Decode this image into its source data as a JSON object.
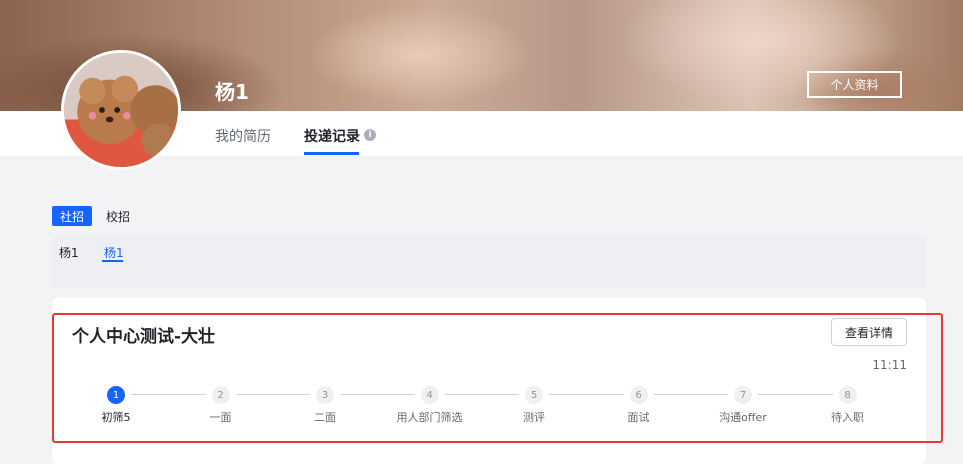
{
  "profile": {
    "name": "杨1",
    "profile_button": "个人资料"
  },
  "tabs": [
    {
      "label": "我的简历",
      "active": false
    },
    {
      "label": "投递记录",
      "active": true
    }
  ],
  "recruit_types": [
    {
      "label": "社招",
      "active": true
    },
    {
      "label": "校招",
      "active": false
    }
  ],
  "resume_tabs": [
    {
      "label": "杨1",
      "active": false
    },
    {
      "label": "杨1",
      "active": true
    }
  ],
  "application": {
    "job_title": "个人中心测试-大壮",
    "detail_button": "查看详情",
    "time": "11:11",
    "current_step": 1,
    "steps": [
      {
        "num": "1",
        "label": "初筛5"
      },
      {
        "num": "2",
        "label": "一面"
      },
      {
        "num": "3",
        "label": "二面"
      },
      {
        "num": "4",
        "label": "用人部门筛选"
      },
      {
        "num": "5",
        "label": "测评"
      },
      {
        "num": "6",
        "label": "面试"
      },
      {
        "num": "7",
        "label": "沟通offer"
      },
      {
        "num": "8",
        "label": "待入职"
      }
    ]
  },
  "colors": {
    "accent": "#1664ff",
    "highlight_border": "#e8392f"
  }
}
